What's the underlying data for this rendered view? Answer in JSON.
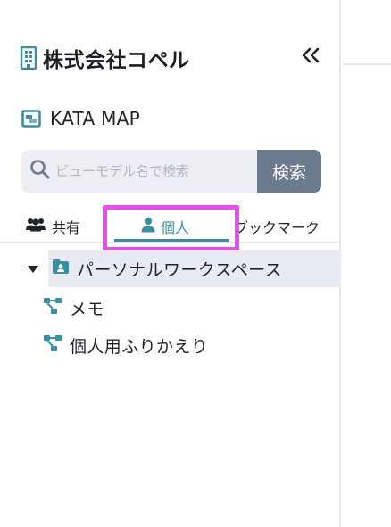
{
  "header": {
    "org_name": "株式会社コペル",
    "collapse_icon": "double-chevron-left-icon"
  },
  "app": {
    "name": "KATA MAP",
    "icon": "map-icon"
  },
  "search": {
    "placeholder": "ビューモデル名で検索",
    "value": "",
    "button_label": "検索"
  },
  "tabs": [
    {
      "label": "共有",
      "icon": "users-icon",
      "active": false
    },
    {
      "label": "個人",
      "icon": "user-icon",
      "active": true
    },
    {
      "label": "ブックマーク",
      "icon": "",
      "active": false
    }
  ],
  "tree": {
    "workspace": {
      "label": "パーソナルワークスペース",
      "icon": "workspace-icon",
      "expanded": true
    },
    "children": [
      {
        "label": "メモ",
        "icon": "diagram-icon"
      },
      {
        "label": "個人用ふりかえり",
        "icon": "diagram-icon"
      }
    ]
  },
  "colors": {
    "accent": "#3a8fa3",
    "highlight": "#e64ef0",
    "search_button": "#6c7a8f",
    "selected_row": "#e8ebf1"
  }
}
